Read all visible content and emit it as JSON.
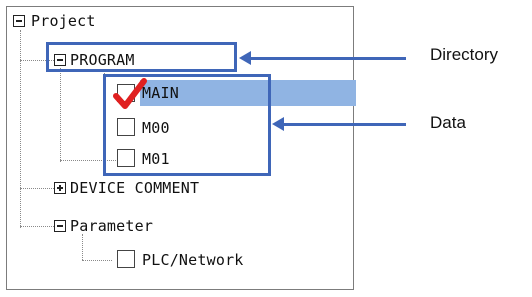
{
  "tree": {
    "root": {
      "label": "Project",
      "expanded": true
    },
    "items": [
      {
        "label": "PROGRAM",
        "expanded": true
      },
      {
        "label": "MAIN",
        "checked": true,
        "selected": true
      },
      {
        "label": "M00",
        "checked": false
      },
      {
        "label": "M01",
        "checked": false
      },
      {
        "label": "DEVICE COMMENT",
        "expanded": false
      },
      {
        "label": "Parameter",
        "expanded": true
      },
      {
        "label": "PLC/Network",
        "checked": false
      }
    ]
  },
  "annotations": {
    "directory": "Directory",
    "data": "Data"
  },
  "colors": {
    "callout": "#3f66b8",
    "selection": "#90b4e3",
    "checkmark": "#e02020"
  }
}
